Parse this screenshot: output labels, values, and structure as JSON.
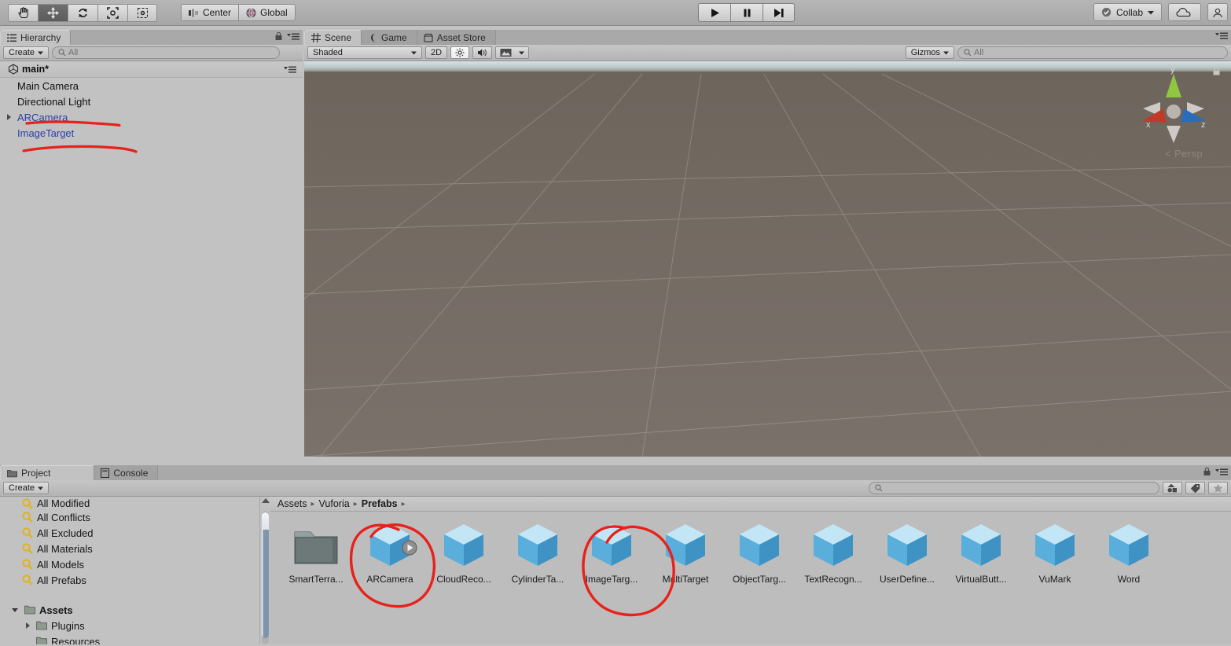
{
  "toolbar": {
    "tools": [
      {
        "name": "hand-tool",
        "label": "Hand",
        "active": false
      },
      {
        "name": "move-tool",
        "label": "Move",
        "active": true
      },
      {
        "name": "rotate-tool",
        "label": "Rotate",
        "active": false
      },
      {
        "name": "scale-tool",
        "label": "Scale",
        "active": false
      },
      {
        "name": "rect-tool",
        "label": "Rect",
        "active": false
      }
    ],
    "pivot_label": "Center",
    "space_label": "Global",
    "play_label": "Play",
    "pause_label": "Pause",
    "step_label": "Step",
    "collab_label": "Collab",
    "cloud_label": "Cloud",
    "account_label": "Account"
  },
  "hierarchy": {
    "tab_label": "Hierarchy",
    "create_label": "Create",
    "search_placeholder": "All",
    "scene_name": "main*",
    "items": [
      {
        "label": "Main Camera",
        "prefab": false,
        "expandable": false
      },
      {
        "label": "Directional Light",
        "prefab": false,
        "expandable": false
      },
      {
        "label": "ARCamera",
        "prefab": true,
        "expandable": true
      },
      {
        "label": "ImageTarget",
        "prefab": true,
        "expandable": false
      }
    ]
  },
  "scene": {
    "tabs": [
      {
        "label": "Scene",
        "icon": "grid-icon",
        "active": true
      },
      {
        "label": "Game",
        "icon": "gamepad-icon",
        "active": false
      },
      {
        "label": "Asset Store",
        "icon": "store-icon",
        "active": false
      }
    ],
    "draw_mode": "Shaded",
    "toggle_2d": "2D",
    "lighting_label": "Lighting",
    "audio_label": "Audio",
    "fx_label": "Effects",
    "gizmos_label": "Gizmos",
    "search_placeholder": "All",
    "perspective_label": "Persp",
    "axis_x": "x",
    "axis_y": "y",
    "axis_z": "z"
  },
  "project": {
    "tabs": [
      {
        "label": "Project",
        "icon": "folder-icon",
        "active": true
      },
      {
        "label": "Console",
        "icon": "console-icon",
        "active": false
      }
    ],
    "create_label": "Create",
    "search_placeholder": "",
    "tree": [
      {
        "label": "All Modified",
        "icon": "search-icon",
        "indent": 0,
        "bold": false,
        "clipped": true
      },
      {
        "label": "All Conflicts",
        "icon": "search-icon",
        "indent": 0,
        "bold": false
      },
      {
        "label": "All Excluded",
        "icon": "search-icon",
        "indent": 0,
        "bold": false
      },
      {
        "label": "All Materials",
        "icon": "search-icon",
        "indent": 0,
        "bold": false
      },
      {
        "label": "All Models",
        "icon": "search-icon",
        "indent": 0,
        "bold": false
      },
      {
        "label": "All Prefabs",
        "icon": "search-icon",
        "indent": 0,
        "bold": false
      },
      {
        "label": "",
        "icon": "",
        "indent": 0,
        "bold": false,
        "spacer": true
      },
      {
        "label": "Assets",
        "icon": "folder-icon",
        "indent": 0,
        "bold": true,
        "expanded": true
      },
      {
        "label": "Plugins",
        "icon": "folder-icon",
        "indent": 1,
        "bold": false,
        "expandable": true
      },
      {
        "label": "Resources",
        "icon": "folder-icon",
        "indent": 1,
        "bold": false
      }
    ],
    "breadcrumb": [
      {
        "label": "Assets",
        "bold": false
      },
      {
        "label": "Vuforia",
        "bold": false
      },
      {
        "label": "Prefabs",
        "bold": true
      }
    ],
    "assets": [
      {
        "label": "SmartTerra...",
        "type": "folder"
      },
      {
        "label": "ARCamera",
        "type": "prefab",
        "badge": "play"
      },
      {
        "label": "CloudReco...",
        "type": "prefab"
      },
      {
        "label": "CylinderTa...",
        "type": "prefab"
      },
      {
        "label": "ImageTarg...",
        "type": "prefab"
      },
      {
        "label": "MultiTarget",
        "type": "prefab"
      },
      {
        "label": "ObjectTarg...",
        "type": "prefab"
      },
      {
        "label": "TextRecogn...",
        "type": "prefab"
      },
      {
        "label": "UserDefine...",
        "type": "prefab"
      },
      {
        "label": "VirtualButt...",
        "type": "prefab"
      },
      {
        "label": "VuMark",
        "type": "prefab"
      },
      {
        "label": "Word",
        "type": "prefab"
      }
    ]
  },
  "annotations": {
    "color": "#e8211a",
    "marks": [
      {
        "name": "underline-arcamera-hierarchy",
        "type": "underline"
      },
      {
        "name": "underline-imagetarget-hierarchy",
        "type": "underline"
      },
      {
        "name": "circle-arcamera-prefab",
        "type": "circle"
      },
      {
        "name": "circle-imagetarget-prefab",
        "type": "circle"
      }
    ]
  },
  "colors": {
    "panel_bg": "#c2c2c2",
    "toolbar_bg": "#a6a6a6",
    "prefab_text": "#2c3ea8",
    "annotation_red": "#e8211a",
    "cube_blue": "#6fc0e8"
  }
}
